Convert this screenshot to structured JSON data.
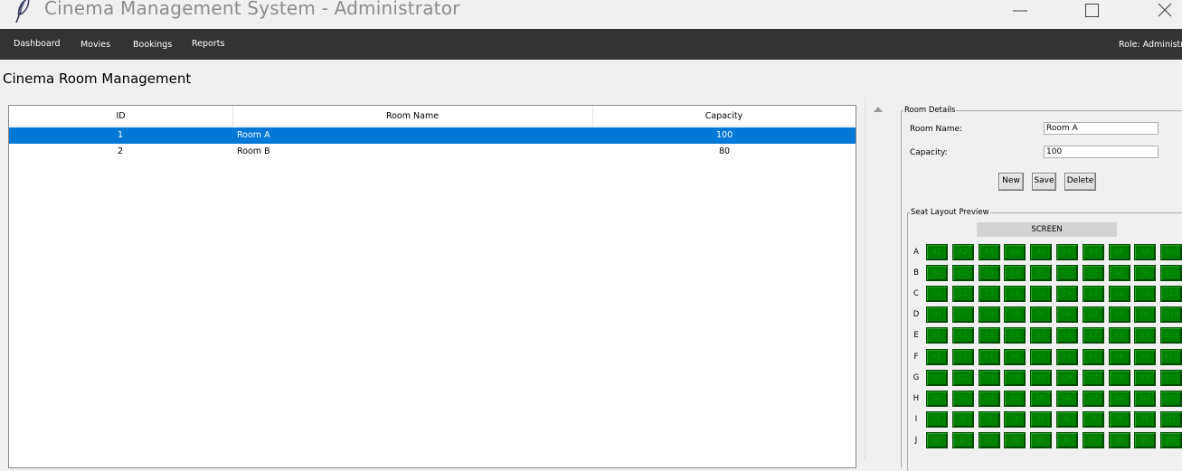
{
  "window": {
    "title": "Cinema Management System - Administrator"
  },
  "menu": {
    "items": [
      "Dashboard",
      "Movies",
      "Bookings",
      "Reports"
    ],
    "role_text": "Role: Administrato"
  },
  "page": {
    "title": "Cinema Room Management"
  },
  "table": {
    "columns": [
      "ID",
      "Room Name",
      "Capacity"
    ],
    "rows": [
      {
        "id": "1",
        "name": "Room A",
        "capacity": "100",
        "selected": true
      },
      {
        "id": "2",
        "name": "Room B",
        "capacity": "80",
        "selected": false
      }
    ]
  },
  "details": {
    "legend": "Room Details",
    "room_name_label": "Room Name:",
    "room_name_value": "Room A",
    "capacity_label": "Capacity:",
    "capacity_value": "100",
    "buttons": {
      "new": "New",
      "save": "Save",
      "delete": "Delete"
    }
  },
  "seat_layout": {
    "legend": "Seat Layout Preview",
    "screen_label": "SCREEN",
    "rows": [
      "A",
      "B",
      "C",
      "D",
      "E",
      "F",
      "G",
      "H",
      "I",
      "J"
    ],
    "seats_per_row": 10,
    "seat_color": "#008000"
  },
  "colors": {
    "menubar": "#333333",
    "selection": "#0078d7"
  }
}
